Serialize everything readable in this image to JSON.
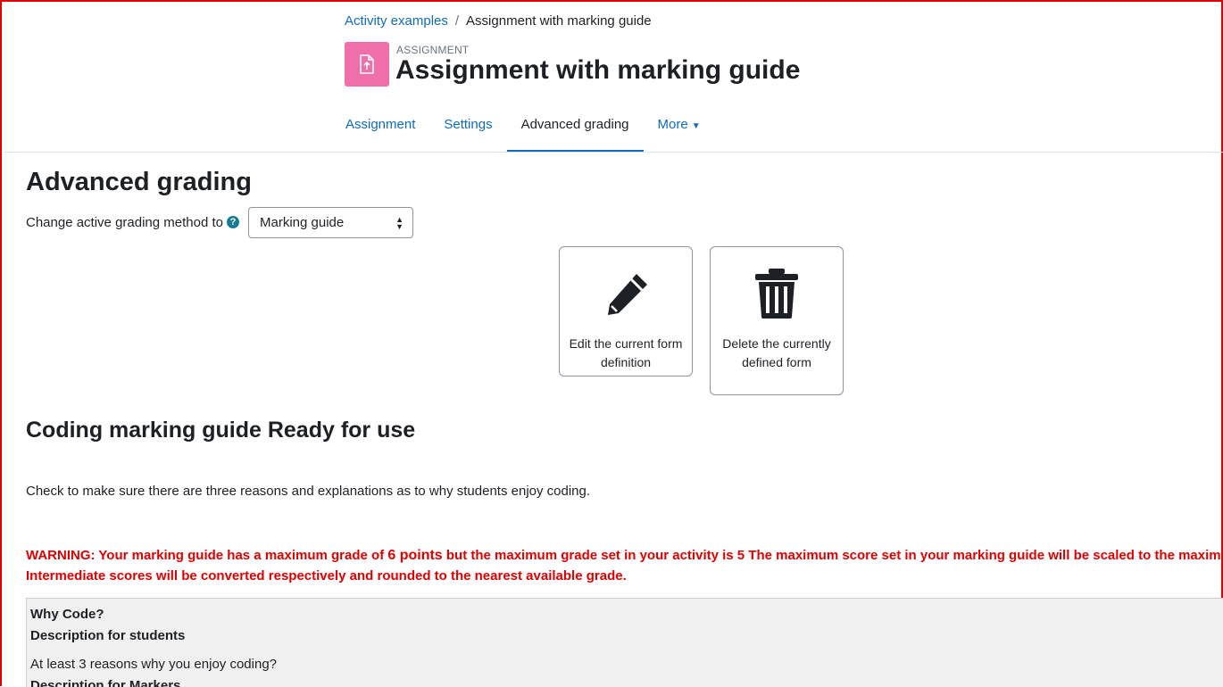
{
  "breadcrumb": {
    "parent": "Activity examples",
    "separator": "/",
    "current": "Assignment with marking guide"
  },
  "activity": {
    "type_label": "ASSIGNMENT",
    "title": "Assignment with marking guide",
    "icon": "assignment-upload-icon",
    "icon_color": "#f06ea9"
  },
  "tabs": [
    {
      "label": "Assignment"
    },
    {
      "label": "Settings"
    },
    {
      "label": "Advanced grading"
    },
    {
      "label": "More"
    }
  ],
  "main": {
    "heading": "Advanced grading",
    "method_label": "Change active grading method to",
    "method_selected": "Marking guide",
    "actions": {
      "edit_label": "Edit the current form definition",
      "delete_label": "Delete the currently defined form"
    },
    "guide_heading": "Coding marking guide Ready for use",
    "guide_description": "Check to make sure there are three reasons and explanations as to why students enjoy coding.",
    "warning": {
      "part1": "WARNING: Your marking guide has a maximum grade of ",
      "points": "6 points",
      "part2": " but the maximum grade set in your activity is 5 The maximum score set in your marking guide will be scaled to the maximum grade in the module.",
      "line2": "Intermediate scores will be converted respectively and rounded to the nearest available grade."
    },
    "criterion": {
      "name": "Why Code?",
      "students_label": "Description for students",
      "students_text": "At least 3 reasons why you enjoy coding?",
      "markers_label": "Description for Markers"
    }
  },
  "colors": {
    "link": "#0f6cbf",
    "warning": "#e00000",
    "frame": "#e00000"
  }
}
